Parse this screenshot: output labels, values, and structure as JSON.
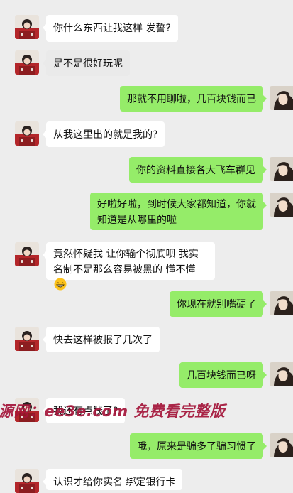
{
  "messages": [
    {
      "side": "left",
      "text": "你什么东西让我这样 发誓?"
    },
    {
      "side": "left",
      "text": "是不是很好玩呢"
    },
    {
      "side": "right",
      "text": "那就不用聊啦，几百块钱而已"
    },
    {
      "side": "left",
      "text": "从我这里出的就是我的?"
    },
    {
      "side": "right",
      "text": "你的资料直接各大飞车群见"
    },
    {
      "side": "right",
      "text": "好啦好啦，到时候大家都知道，你就知道是从哪里的啦"
    },
    {
      "side": "left",
      "text": "竟然怀疑我 让你输个彻底呗 我实名制不是那么容易被黑的 懂不懂",
      "emoji": "grin-emoji"
    },
    {
      "side": "right",
      "text": "你现在就别嘴硬了"
    },
    {
      "side": "left",
      "text": "快去这样被报了几次了"
    },
    {
      "side": "right",
      "text": "几百块钱而已呀"
    },
    {
      "side": "left",
      "text": "我还有点钱了?"
    },
    {
      "side": "right",
      "text": "哦，原来是骗多了骗习惯了"
    },
    {
      "side": "left",
      "text": "认识才给你实名 绑定银行卡"
    }
  ],
  "watermark": "源网：ee3e.com 免费看完整版",
  "colors": {
    "background": "#ededed",
    "incoming": "#ffffff",
    "outgoing": "#95ec69",
    "watermark": "#a4153a"
  }
}
